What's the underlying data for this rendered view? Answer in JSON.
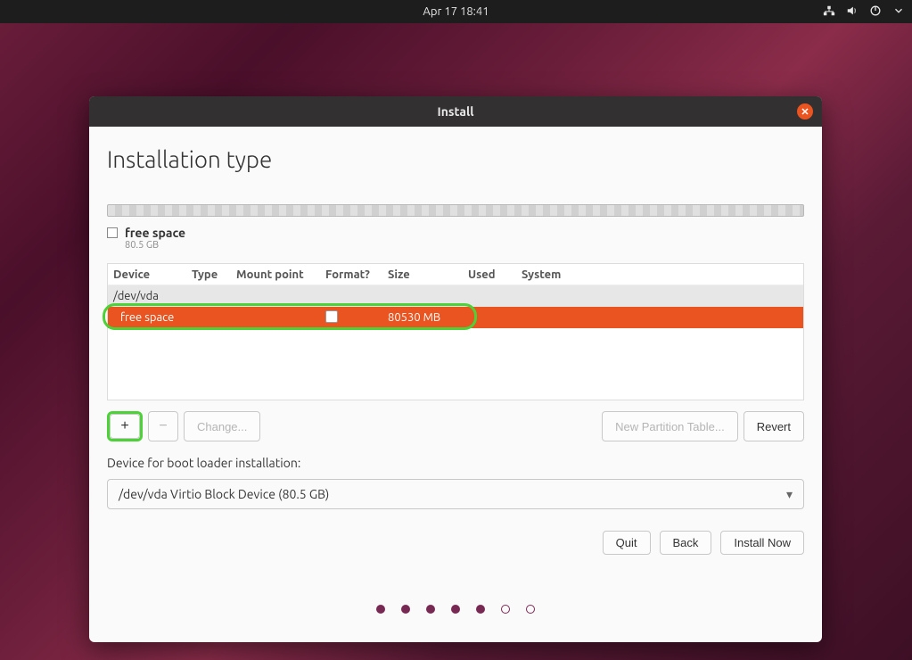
{
  "topbar": {
    "datetime": "Apr 17  18:41"
  },
  "window": {
    "title": "Install"
  },
  "page": {
    "heading": "Installation type"
  },
  "legend": {
    "name": "free space",
    "size": "80.5 GB"
  },
  "columns": {
    "device": "Device",
    "type": "Type",
    "mount": "Mount point",
    "format": "Format?",
    "size": "Size",
    "used": "Used",
    "system": "System"
  },
  "rows": {
    "disk": {
      "device": "/dev/vda"
    },
    "free": {
      "device": "free space",
      "size": "80530 MB"
    }
  },
  "toolbar": {
    "add": "+",
    "remove": "−",
    "change": "Change...",
    "new_table": "New Partition Table...",
    "revert": "Revert"
  },
  "bootloader": {
    "label": "Device for boot loader installation:",
    "value": "/dev/vda Virtio Block Device (80.5 GB)"
  },
  "actions": {
    "quit": "Quit",
    "back": "Back",
    "install": "Install Now"
  },
  "dots": {
    "total": 7,
    "active": 5
  }
}
